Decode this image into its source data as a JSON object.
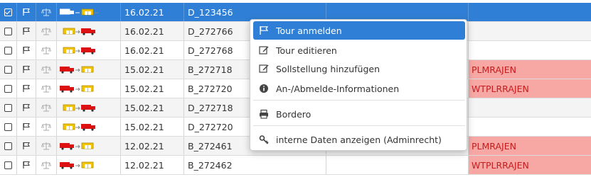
{
  "rows": [
    {
      "date": "16.02.21",
      "id": "D_123456",
      "note": "",
      "checked": true,
      "selected": true,
      "route": "yellow-red-outline"
    },
    {
      "date": "16.02.21",
      "id": "D_272766",
      "note": "",
      "checked": false,
      "selected": false,
      "route": "yellow-red"
    },
    {
      "date": "16.02.21",
      "id": "D_272768",
      "note": "",
      "checked": false,
      "selected": false,
      "route": "yellow-red"
    },
    {
      "date": "15.02.21",
      "id": "B_272718",
      "note": "PLMRAJEN",
      "checked": false,
      "selected": false,
      "route": "red-yellow"
    },
    {
      "date": "15.02.21",
      "id": "B_272720",
      "note": "WTPLRRAJEN",
      "checked": false,
      "selected": false,
      "route": "red-yellow"
    },
    {
      "date": "15.02.21",
      "id": "D_272718",
      "note": "",
      "checked": false,
      "selected": false,
      "route": "yellow-red"
    },
    {
      "date": "15.02.21",
      "id": "D_272720",
      "note": "",
      "checked": false,
      "selected": false,
      "route": "yellow-red"
    },
    {
      "date": "12.02.21",
      "id": "B_272461",
      "note": "PLMRAJEN",
      "checked": false,
      "selected": false,
      "route": "red-yellow"
    },
    {
      "date": "12.02.21",
      "id": "B_272462",
      "note": "WTPLRRAJEN",
      "checked": false,
      "selected": false,
      "route": "red-yellow"
    }
  ],
  "menu": {
    "items": [
      {
        "label": "Tour anmelden",
        "icon": "flag-icon",
        "active": true
      },
      {
        "label": "Tour editieren",
        "icon": "edit-icon",
        "active": false
      },
      {
        "label": "Sollstellung hinzufügen",
        "icon": "edit-icon",
        "active": false
      },
      {
        "label": "An-/Abmelde-Informationen",
        "icon": "info-icon",
        "active": false
      },
      {
        "label": "Bordero",
        "icon": "print-icon",
        "active": false
      },
      {
        "label": "interne Daten anzeigen (Adminrecht)",
        "icon": "key-icon",
        "active": false
      }
    ]
  },
  "colors": {
    "selection": "#2f7fd6",
    "warning_bg": "#f7a8a5",
    "warning_text": "#c41d1d"
  }
}
